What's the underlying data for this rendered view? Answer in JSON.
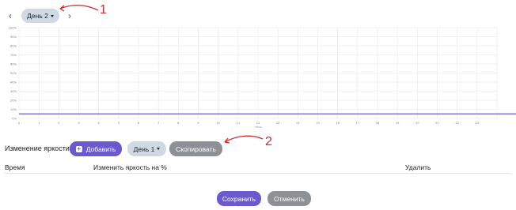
{
  "topbar": {
    "prev_icon": "chevron-left-icon",
    "next_icon": "chevron-right-icon",
    "day_label": "День 2",
    "chevron_left": "‹",
    "chevron_right": "›"
  },
  "chart_data": {
    "type": "line",
    "xlabel": "Часы",
    "ylabel": "",
    "x_ticks": [
      "0",
      "1",
      "2",
      "3",
      "4",
      "5",
      "6",
      "7",
      "8",
      "9",
      "10",
      "11",
      "12",
      "13",
      "14",
      "15",
      "16",
      "17",
      "18",
      "19",
      "20",
      "21",
      "22",
      "23"
    ],
    "y_ticks": [
      "100%",
      "90%",
      "80%",
      "70%",
      "60%",
      "50%",
      "40%",
      "30%",
      "20%",
      "10%",
      "0%"
    ],
    "ylim": [
      0,
      100
    ],
    "xlim": [
      0,
      24
    ],
    "series": [
      {
        "values": [
          5,
          5,
          5,
          5,
          5,
          5,
          5,
          5,
          5,
          5,
          5,
          5,
          5,
          5,
          5,
          5,
          5,
          5,
          5,
          5,
          5,
          5,
          5,
          5,
          5
        ],
        "color": "#6a5acd"
      }
    ],
    "grid": true
  },
  "brightness": {
    "title": "Изменение яркости",
    "add_label": "Добавить",
    "day_label": "День 1",
    "copy_label": "Скопировать",
    "columns": [
      "Время",
      "Изменить яркость на %",
      "Удалить"
    ]
  },
  "footer": {
    "save_label": "Сохранить",
    "cancel_label": "Отменить"
  },
  "annotations": {
    "one": "1",
    "two": "2",
    "color": "#d9262b"
  },
  "colors": {
    "primary": "#6a5acd",
    "day_pill": "#cfd8e3",
    "gray_button": "#8d9094"
  }
}
